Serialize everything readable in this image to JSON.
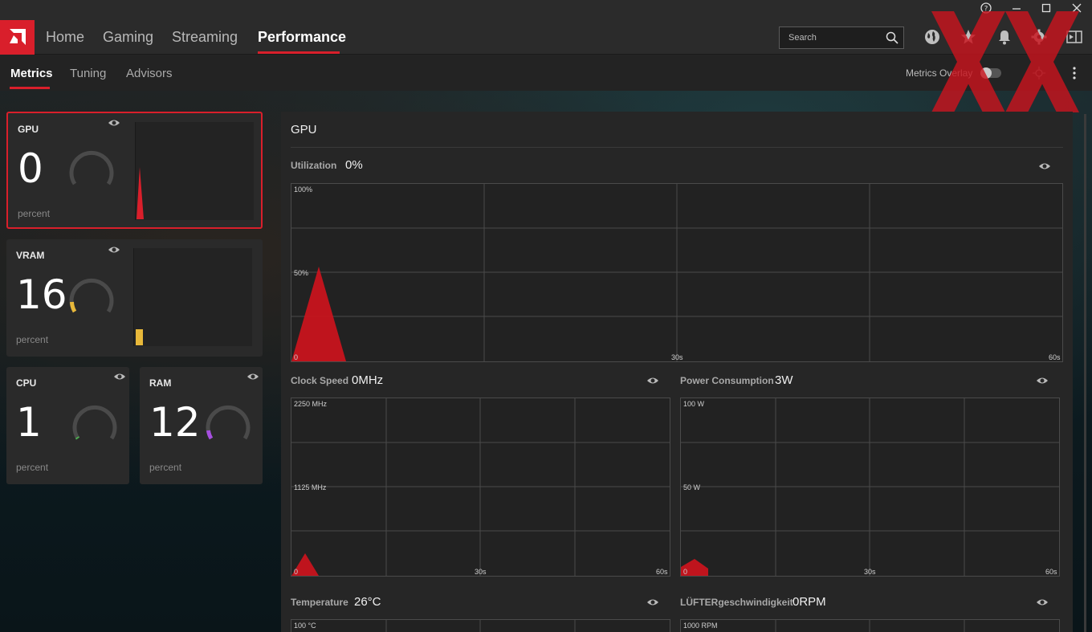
{
  "window": {
    "controls": [
      "?",
      "–",
      "☐",
      "✕"
    ]
  },
  "topnav": {
    "tabs": [
      {
        "label": "Home"
      },
      {
        "label": "Gaming"
      },
      {
        "label": "Streaming"
      },
      {
        "label": "Performance"
      }
    ],
    "active": "Performance",
    "search_placeholder": "Search"
  },
  "subnav": {
    "tabs": [
      {
        "label": "Metrics"
      },
      {
        "label": "Tuning"
      },
      {
        "label": "Advisors"
      }
    ],
    "active": "Metrics",
    "overlay_label": "Metrics Overlay",
    "overlay_enabled": false
  },
  "cards": {
    "gpu": {
      "title": "GPU",
      "value": "0",
      "unit": "percent",
      "gauge": 0
    },
    "vram": {
      "title": "VRAM",
      "value": "16",
      "unit": "percent",
      "gauge": 16
    },
    "cpu": {
      "title": "CPU",
      "value": "1",
      "unit": "percent",
      "gauge": 1
    },
    "ram": {
      "title": "RAM",
      "value": "12",
      "unit": "percent",
      "gauge": 12
    }
  },
  "colors": {
    "accent": "#d91f2b",
    "vram": "#e8b83a",
    "cpu": "#4caf50",
    "ram": "#a64ee0"
  },
  "panel": {
    "title": "GPU",
    "utilization": {
      "label": "Utilization",
      "value": "0%",
      "y_top": "100%",
      "y_mid": "50%",
      "x_start": "0",
      "x_mid": "30s",
      "x_end": "60s"
    },
    "clock": {
      "label": "Clock Speed",
      "value": "0MHz",
      "y_top": "2250 MHz",
      "y_mid": "1125 MHz",
      "x_start": "0",
      "x_mid": "30s",
      "x_end": "60s"
    },
    "power": {
      "label": "Power Consumption",
      "value": "3W",
      "y_top": "100 W",
      "y_mid": "50 W",
      "x_start": "0",
      "x_mid": "30s",
      "x_end": "60s"
    },
    "temperature": {
      "label": "Temperature",
      "value": "26°C",
      "y_top": "100 °C"
    },
    "fan": {
      "label": "LÜFTERgeschwindigkeit",
      "value": "0RPM",
      "y_top": "1000 RPM"
    }
  }
}
